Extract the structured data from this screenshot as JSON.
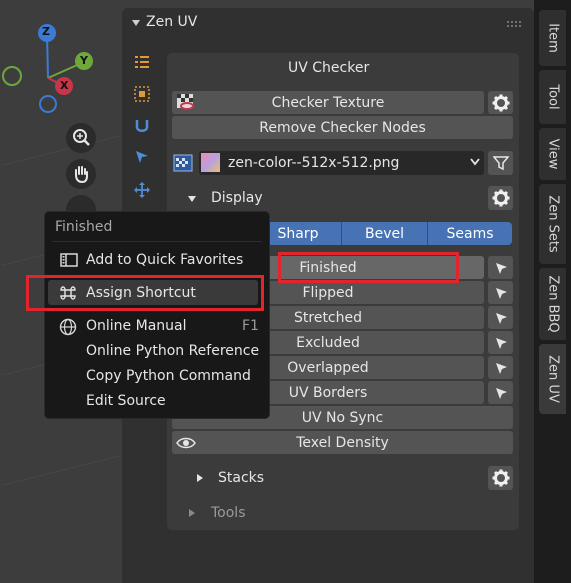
{
  "panel": {
    "title": "Zen UV"
  },
  "uv_checker": {
    "heading": "UV Checker",
    "checker_texture_label": "Checker Texture",
    "remove_nodes_label": "Remove Checker Nodes",
    "image_name": "zen-color--512x-512.png"
  },
  "display": {
    "label": "Display",
    "tabs": [
      "Sharp",
      "Bevel",
      "Seams"
    ],
    "rows": [
      "Finished",
      "Flipped",
      "Stretched",
      "Excluded",
      "Overlapped",
      "UV Borders",
      "UV No Sync",
      "Texel Density"
    ]
  },
  "stacks": {
    "label": "Stacks"
  },
  "tools": {
    "label": "Tools"
  },
  "side_tabs": [
    "Item",
    "Tool",
    "View",
    "Zen Sets",
    "Zen BBQ",
    "Zen UV"
  ],
  "gizmo": {
    "z": "Z",
    "y": "Y",
    "x": "X"
  },
  "context_menu": {
    "title": "Finished",
    "items": [
      {
        "label": "Add to Quick Favorites",
        "shortcut": ""
      },
      {
        "label": "Assign Shortcut",
        "shortcut": ""
      },
      {
        "label": "Online Manual",
        "shortcut": "F1"
      },
      {
        "label": "Online Python Reference",
        "shortcut": ""
      },
      {
        "label": "Copy Python Command",
        "shortcut": ""
      },
      {
        "label": "Edit Source",
        "shortcut": ""
      }
    ]
  },
  "colors": {
    "accent_blue": "#4772b3",
    "highlight_red": "#e3242b",
    "panel_bg": "#303030",
    "menu_bg": "#181818"
  }
}
